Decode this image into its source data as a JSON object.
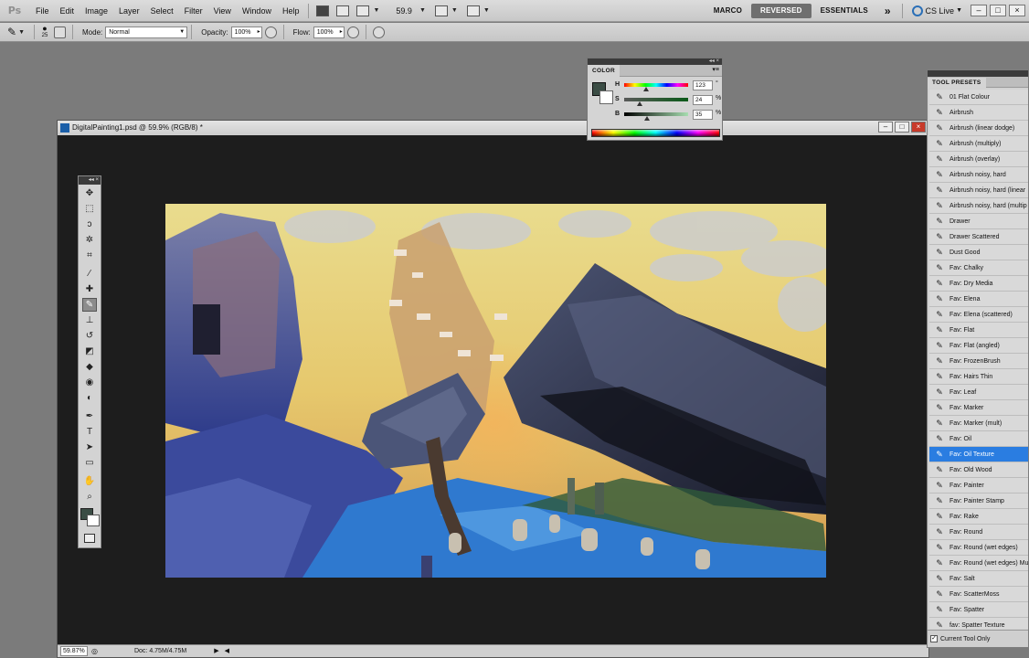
{
  "app": {
    "logo": "Ps"
  },
  "menu": [
    "File",
    "Edit",
    "Image",
    "Layer",
    "Select",
    "Filter",
    "View",
    "Window",
    "Help"
  ],
  "menubar": {
    "zoom": "59.9"
  },
  "workspaces": [
    "MARCO",
    "REVERSED",
    "ESSENTIALS"
  ],
  "workspace_active": "REVERSED",
  "workspace_more": "»",
  "cslive": "CS Live",
  "window_buttons": {
    "minimize": "–",
    "restore": "□",
    "close": "×"
  },
  "options": {
    "brush_size": "25",
    "mode_label": "Mode:",
    "mode_value": "Normal",
    "opacity_label": "Opacity:",
    "opacity_value": "100%",
    "flow_label": "Flow:",
    "flow_value": "100%"
  },
  "document": {
    "title": "DigitalPainting1.psd @ 59.9% (RGB/8) *",
    "status_zoom": "59.87%",
    "status_doc": "Doc: 4.75M/4.75M"
  },
  "color_panel": {
    "tab": "COLOR",
    "fg_color": "#3b4d45",
    "h_value": "123",
    "s_value": "24",
    "b_value": "35",
    "h_unit": "°",
    "s_unit": "%",
    "b_unit": "%",
    "h_label": "H",
    "s_label": "S",
    "b_label": "B",
    "h_level": 0.34,
    "s_level": 0.24,
    "b_level": 0.35
  },
  "tool_presets": {
    "tab": "TOOL PRESETS",
    "selected_index": 23,
    "items": [
      "01 Flat Colour",
      "Airbrush",
      "Airbrush (linear dodge)",
      "Airbrush (multiply)",
      "Airbrush (overlay)",
      "Airbrush noisy, hard",
      "Airbrush noisy, hard (linear",
      "Airbrush noisy, hard (multip",
      "Drawer",
      "Drawer Scattered",
      "Dust Good",
      "Fav: Chalky",
      "Fav: Dry Media",
      "Fav: Elena",
      "Fav: Elena (scattered)",
      "Fav: Flat",
      "Fav: Flat (angled)",
      "Fav: FrozenBrush",
      "Fav: Hairs Thin",
      "Fav: Leaf",
      "Fav: Marker",
      "Fav: Marker (mult)",
      "Fav: Oil",
      "Fav: Oil Texture",
      "Fav: Old Wood",
      "Fav: Painter",
      "Fav: Painter Stamp",
      "Fav: Rake",
      "Fav: Round",
      "Fav: Round (wet edges)",
      "Fav: Round (wet edges) Mu",
      "Fav: Salt",
      "Fav: ScatterMoss",
      "Fav: Spatter",
      "fav: Spatter Texture"
    ],
    "current_tool_only": "Current Tool Only"
  },
  "toolbox": {
    "tools": [
      {
        "name": "move-tool-icon",
        "glyph": "✥"
      },
      {
        "name": "marquee-tool-icon",
        "glyph": "⬚"
      },
      {
        "name": "lasso-tool-icon",
        "glyph": "ↄ"
      },
      {
        "name": "quick-select-tool-icon",
        "glyph": "✲"
      },
      {
        "name": "crop-tool-icon",
        "glyph": "⌗"
      },
      {
        "name": "eyedropper-tool-icon",
        "glyph": "⁄"
      },
      {
        "name": "healing-brush-tool-icon",
        "glyph": "✚"
      },
      {
        "name": "brush-tool-icon",
        "glyph": "✎"
      },
      {
        "name": "clone-stamp-tool-icon",
        "glyph": "⊥"
      },
      {
        "name": "history-brush-tool-icon",
        "glyph": "↺"
      },
      {
        "name": "eraser-tool-icon",
        "glyph": "◩"
      },
      {
        "name": "paint-bucket-tool-icon",
        "glyph": "◆"
      },
      {
        "name": "blur-tool-icon",
        "glyph": "◉"
      },
      {
        "name": "dodge-tool-icon",
        "glyph": "◐"
      },
      {
        "name": "pen-tool-icon",
        "glyph": "✒"
      },
      {
        "name": "type-tool-icon",
        "glyph": "T"
      },
      {
        "name": "path-select-tool-icon",
        "glyph": "➤"
      },
      {
        "name": "shape-tool-icon",
        "glyph": "▭"
      },
      {
        "name": "hand-tool-icon",
        "glyph": "✋"
      },
      {
        "name": "zoom-tool-icon",
        "glyph": "⌕"
      }
    ],
    "selected_tool": "brush-tool-icon",
    "fg_color": "#3b4d45",
    "bg_color": "#ffffff"
  }
}
